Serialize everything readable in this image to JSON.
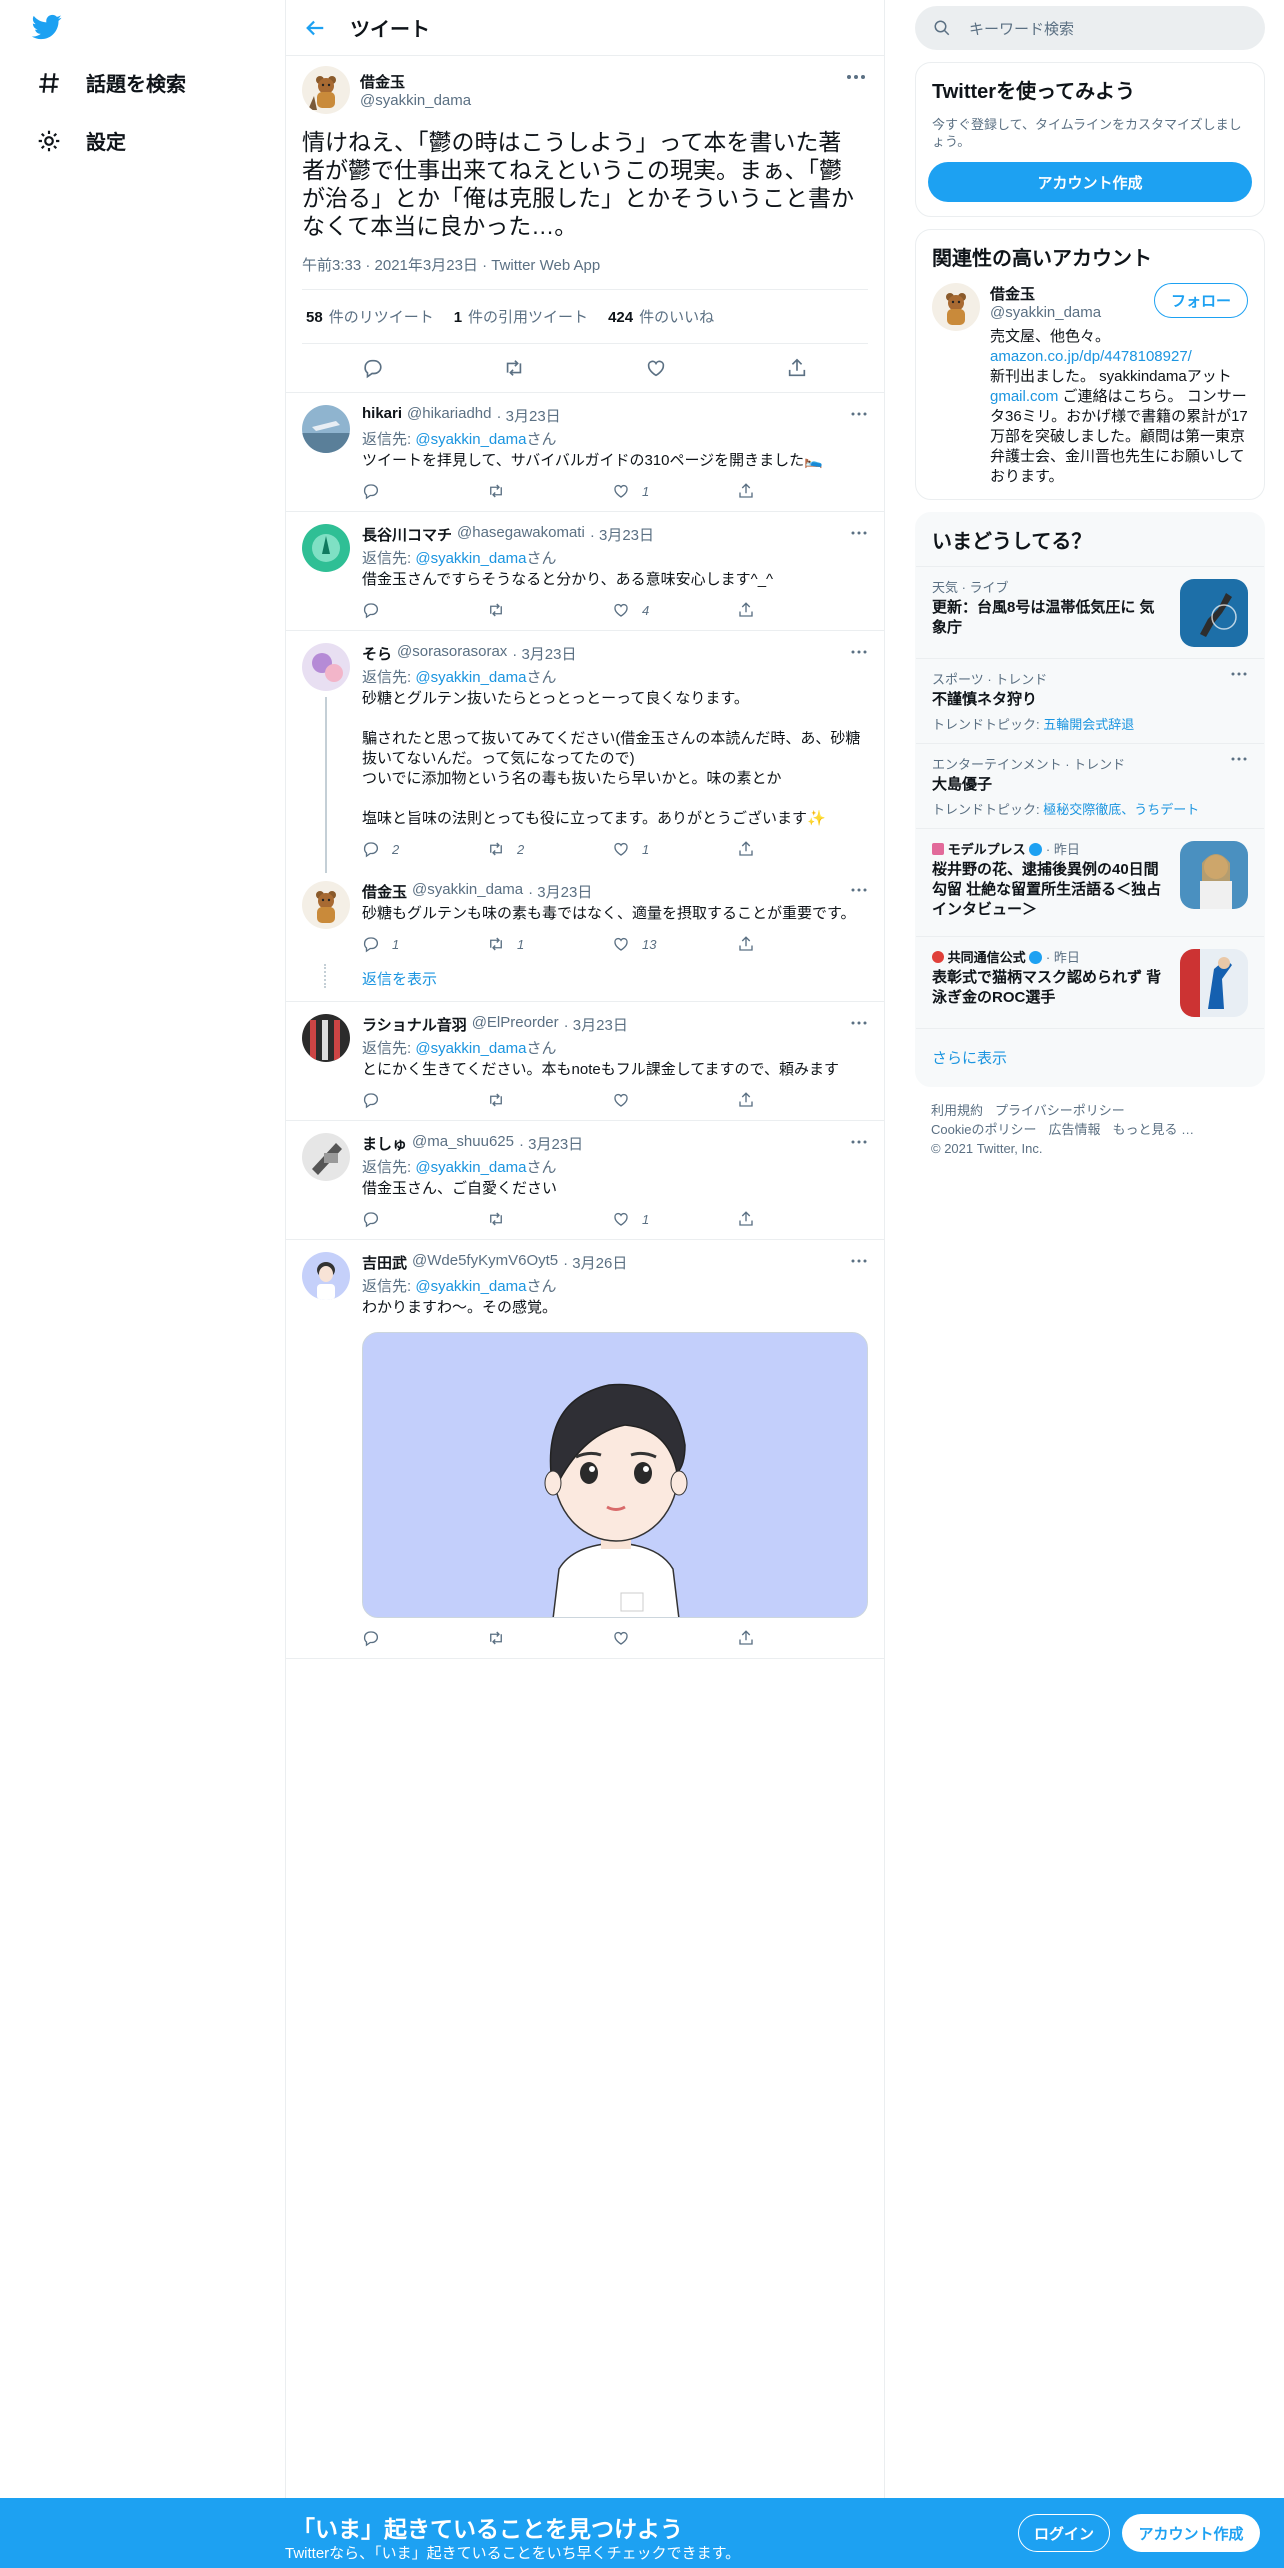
{
  "nav": {
    "explore_label": "話題を検索",
    "settings_label": "設定"
  },
  "header": {
    "title": "ツイート"
  },
  "focus_tweet": {
    "display_name": "借金玉",
    "handle": "@syakkin_dama",
    "text": "情けねえ、「鬱の時はこうしよう」って本を書いた著者が鬱で仕事出来てねえというこの現実。まぁ、「鬱が治る」とか「俺は克服した」とかそういうこと書かなくて本当に良かった…。",
    "meta": "午前3:33 · 2021年3月23日 · Twitter Web App",
    "retweets_count": "58",
    "retweets_label": "件のリツイート",
    "quotes_count": "1",
    "quotes_label": "件の引用ツイート",
    "likes_count": "424",
    "likes_label": "件のいいね"
  },
  "replies": [
    {
      "display_name": "hikari",
      "handle": "@hikariadhd",
      "date": "· 3月23日",
      "replying_prefix": "返信先: ",
      "replying_to": "@syakkin_dama",
      "replying_suffix": "さん",
      "text": "ツイートを拝見して、サバイバルガイドの310ページを開きました🛌",
      "replies": "",
      "retweets": "",
      "likes": "1"
    },
    {
      "display_name": "長谷川コマチ",
      "handle": "@hasegawakomati",
      "date": "· 3月23日",
      "replying_prefix": "返信先: ",
      "replying_to": "@syakkin_dama",
      "replying_suffix": "さん",
      "text": "借金玉さんですらそうなると分かり、ある意味安心します^_^",
      "replies": "",
      "retweets": "",
      "likes": "4"
    },
    {
      "display_name": "そら",
      "handle": "@sorasorasorax",
      "date": "· 3月23日",
      "replying_prefix": "返信先: ",
      "replying_to": "@syakkin_dama",
      "replying_suffix": "さん",
      "text": "砂糖とグルテン抜いたらとっとっとーって良くなります。\n\n騙されたと思って抜いてみてください(借金玉さんの本読んだ時、あ、砂糖抜いてないんだ。って気になってたので)\nついでに添加物という名の毒も抜いたら早いかと。味の素とか\n\n塩味と旨味の法則とっても役に立ってます。ありがとうございます✨",
      "replies": "2",
      "retweets": "2",
      "likes": "1"
    },
    {
      "display_name": "借金玉",
      "handle": "@syakkin_dama",
      "date": "· 3月23日",
      "text": "砂糖もグルテンも味の素も毒ではなく、適量を摂取することが重要です。",
      "replies": "1",
      "retweets": "1",
      "likes": "13"
    },
    {
      "display_name": "ラショナル音羽",
      "handle": "@ElPreorder",
      "date": "· 3月23日",
      "replying_prefix": "返信先: ",
      "replying_to": "@syakkin_dama",
      "replying_suffix": "さん",
      "text": "とにかく生きてください。本もnoteもフル課金してますので、頼みます",
      "replies": "",
      "retweets": "",
      "likes": ""
    },
    {
      "display_name": "ましゅ",
      "handle": "@ma_shuu625",
      "date": "· 3月23日",
      "replying_prefix": "返信先: ",
      "replying_to": "@syakkin_dama",
      "replying_suffix": "さん",
      "text": "借金玉さん、ご自愛ください",
      "replies": "",
      "retweets": "",
      "likes": "1"
    },
    {
      "display_name": "吉田武",
      "handle": "@Wde5fyKymV6Oyt5",
      "date": "· 3月26日",
      "replying_prefix": "返信先: ",
      "replying_to": "@syakkin_dama",
      "replying_suffix": "さん",
      "text": "わかりますわ〜。その感覚。",
      "replies": "",
      "retweets": "",
      "likes": ""
    }
  ],
  "show_replies_label": "返信を表示",
  "sidebar": {
    "search_placeholder": "キーワード検索",
    "signup_card": {
      "title": "Twitterを使ってみよう",
      "description": "今すぐ登録して、タイムラインをカスタマイズしましょう。",
      "button": "アカウント作成"
    },
    "related": {
      "title": "関連性の高いアカウント",
      "display_name": "借金玉",
      "handle": "@syakkin_dama",
      "follow": "フォロー",
      "bio_1": "売文屋、他色々。",
      "bio_link": "amazon.co.jp/dp/4478108927/",
      "bio_2": "新刊出ました。 syakkindamaアット",
      "bio_link2": "gmail.com",
      "bio_3": " ご連絡はこちら。 コンサータ36ミリ。おかげ様で書籍の累計が17万部を突破しました。顧問は第一東京弁護士会、金川晋也先生にお願いしております。"
    },
    "trends": {
      "title": "いまどうしてる？",
      "items": [
        {
          "category": "天気 · ライブ",
          "title": "更新：台風8号は温帯低気圧に 気象庁"
        },
        {
          "category": "スポーツ · トレンド",
          "title": "不謹慎ネタ狩り",
          "topic_prefix": "トレンドトピック: ",
          "topic": "五輪開会式辞退"
        },
        {
          "category": "エンターテインメント · トレンド",
          "title": "大島優子",
          "topic_prefix": "トレンドトピック: ",
          "topic": "極秘交際徹底、うちデート"
        },
        {
          "source": "モデルプレス",
          "time": "· 昨日",
          "title": "桜井野の花、逮捕後異例の40日間勾留 壮絶な留置所生活語る＜独占インタビュー＞"
        },
        {
          "source": "共同通信公式",
          "time": "· 昨日",
          "title": "表彰式で猫柄マスク認められず 背泳ぎ金のROC選手"
        }
      ],
      "show_more": "さらに表示"
    },
    "footer": {
      "terms": "利用規約",
      "privacy": "プライバシーポリシー",
      "cookie": "Cookieのポリシー",
      "ads": "広告情報",
      "more": "もっと見る …",
      "copyright": "© 2021 Twitter, Inc."
    }
  },
  "bottom_bar": {
    "headline": "「いま」起きていることを見つけよう",
    "sub": "Twitterなら、「いま」起きていることをいち早くチェックできます。",
    "login": "ログイン",
    "signup": "アカウント作成"
  },
  "colors": {
    "brand": "#1da1f2",
    "link": "#1b95e0",
    "muted": "#5b7083",
    "border": "#ebeef0"
  }
}
